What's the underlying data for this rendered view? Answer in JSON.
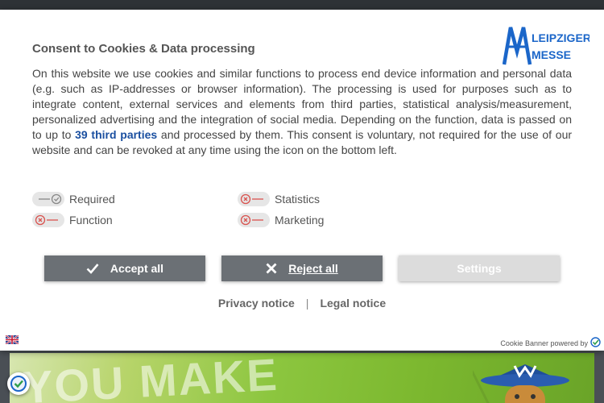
{
  "consent": {
    "title": "Consent to Cookies & Data processing",
    "text_part1": "On this website we use cookies and similar functions to process end device information and personal data (e.g. such as IP-addresses or browser information). The processing is used for purposes such as to integrate content, external services and elements from third parties, statistical analysis/measurement, personalized advertising and the integration of social media. Depending on the function, data is passed on to up to ",
    "third_parties_link": "39 third parties",
    "text_part2": " and processed by them. This consent is voluntary, not required for the use of our website and can be revoked at any time using the icon on the bottom left.",
    "logo_line1": "LEIPZIGER",
    "logo_line2": "MESSE",
    "brand_color": "#1b66c9"
  },
  "toggles": [
    {
      "label": "Required",
      "state": "on-locked"
    },
    {
      "label": "Statistics",
      "state": "off"
    },
    {
      "label": "Function",
      "state": "off"
    },
    {
      "label": "Marketing",
      "state": "off"
    }
  ],
  "buttons": {
    "accept": "Accept all",
    "reject": "Reject all",
    "settings": "Settings"
  },
  "footer_links": {
    "privacy": "Privacy notice",
    "separator": "|",
    "legal": "Legal notice"
  },
  "powered_by": "Cookie Banner powered by",
  "background": {
    "hero_text": "YOU MAKE"
  },
  "colors": {
    "button_dark": "#6b7075",
    "button_disabled": "#dcdcdc",
    "toggle_off_accent": "#d9534f"
  }
}
